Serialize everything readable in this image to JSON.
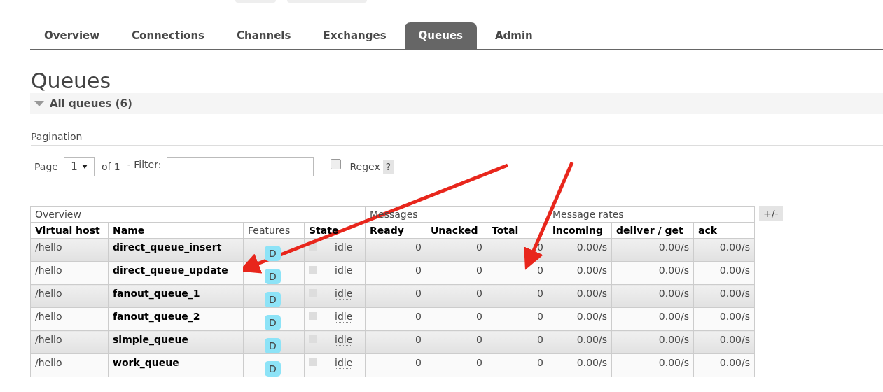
{
  "tabs": [
    {
      "label": "Overview",
      "selected": false
    },
    {
      "label": "Connections",
      "selected": false
    },
    {
      "label": "Channels",
      "selected": false
    },
    {
      "label": "Exchanges",
      "selected": false
    },
    {
      "label": "Queues",
      "selected": true
    },
    {
      "label": "Admin",
      "selected": false
    }
  ],
  "page_title": "Queues",
  "section": {
    "title": "All queues (6)",
    "expanded": true
  },
  "pagination": {
    "title": "Pagination",
    "page_label": "Page",
    "page_value": "1",
    "of_label": "of 1",
    "filter_label": "- Filter:",
    "regex_checked": false,
    "regex_label": "Regex",
    "help": "?"
  },
  "table": {
    "groups": [
      {
        "label": "Overview"
      },
      {
        "label": "Messages"
      },
      {
        "label": "Message rates"
      }
    ],
    "columns": [
      "Virtual host",
      "Name",
      "Features",
      "State",
      "Ready",
      "Unacked",
      "Total",
      "incoming",
      "deliver / get",
      "ack"
    ],
    "toggle": "+/-",
    "rows": [
      {
        "vhost": "/hello",
        "name": "direct_queue_insert",
        "feature": "D",
        "state": "idle",
        "ready": "0",
        "unacked": "0",
        "total": "0",
        "incoming": "0.00/s",
        "deliver": "0.00/s",
        "ack": "0.00/s"
      },
      {
        "vhost": "/hello",
        "name": "direct_queue_update",
        "feature": "D",
        "state": "idle",
        "ready": "0",
        "unacked": "0",
        "total": "0",
        "incoming": "0.00/s",
        "deliver": "0.00/s",
        "ack": "0.00/s"
      },
      {
        "vhost": "/hello",
        "name": "fanout_queue_1",
        "feature": "D",
        "state": "idle",
        "ready": "0",
        "unacked": "0",
        "total": "0",
        "incoming": "0.00/s",
        "deliver": "0.00/s",
        "ack": "0.00/s"
      },
      {
        "vhost": "/hello",
        "name": "fanout_queue_2",
        "feature": "D",
        "state": "idle",
        "ready": "0",
        "unacked": "0",
        "total": "0",
        "incoming": "0.00/s",
        "deliver": "0.00/s",
        "ack": "0.00/s"
      },
      {
        "vhost": "/hello",
        "name": "simple_queue",
        "feature": "D",
        "state": "idle",
        "ready": "0",
        "unacked": "0",
        "total": "0",
        "incoming": "0.00/s",
        "deliver": "0.00/s",
        "ack": "0.00/s"
      },
      {
        "vhost": "/hello",
        "name": "work_queue",
        "feature": "D",
        "state": "idle",
        "ready": "0",
        "unacked": "0",
        "total": "0",
        "incoming": "0.00/s",
        "deliver": "0.00/s",
        "ack": "0.00/s"
      }
    ]
  }
}
